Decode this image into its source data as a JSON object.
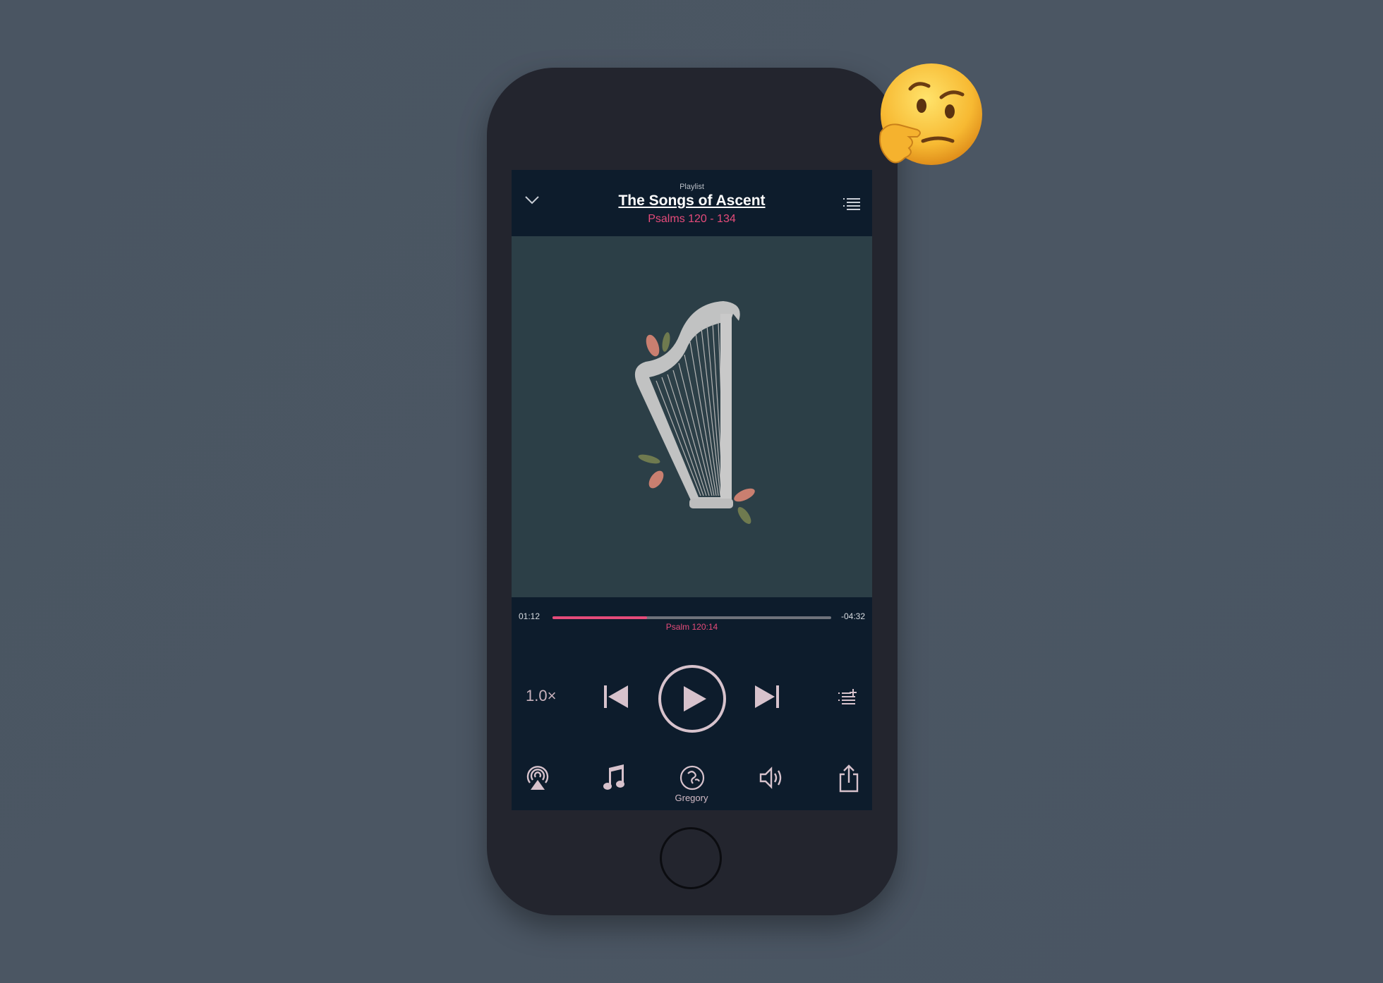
{
  "header": {
    "eyebrow": "Playlist",
    "title": "The Songs of Ascent",
    "subtitle": "Psalms 120 - 134"
  },
  "player": {
    "elapsed": "01:12",
    "remaining": "-04:32",
    "progress_fraction": 0.34,
    "current_verse": "Psalm 120:14",
    "speed": "1.0×"
  },
  "bottom_bar": {
    "voice_label": "Gregory",
    "icons": [
      "airplay-icon",
      "music-note-icon",
      "voice-icon",
      "volume-icon",
      "share-icon"
    ]
  },
  "colors": {
    "accent": "#e54b7a",
    "screen_bg": "#0d1c2c",
    "artwork_bg": "#2c3f47",
    "icon": "#d7c2cc"
  }
}
